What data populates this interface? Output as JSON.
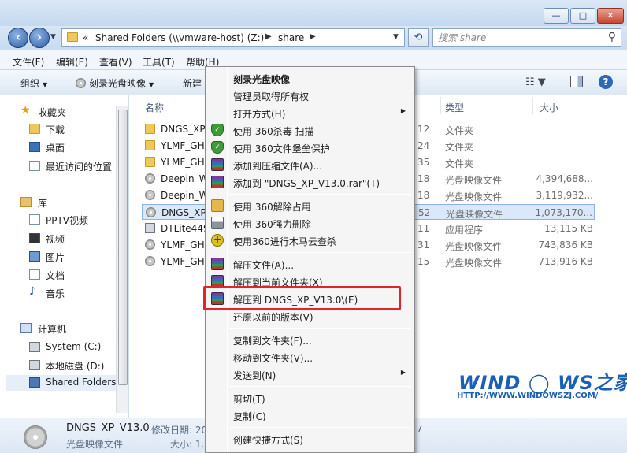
{
  "window": {
    "controls": {
      "minimize": "—",
      "maximize": "□",
      "close": "✕"
    }
  },
  "address": {
    "overflow": "«",
    "crumbs": [
      "Shared Folders (\\\\vmware-host) (Z:)",
      "share"
    ],
    "search_placeholder": "搜索 share"
  },
  "menubar": [
    "文件(F)",
    "编辑(E)",
    "查看(V)",
    "工具(T)",
    "帮助(H)"
  ],
  "toolbar": {
    "organize": "组织",
    "burn": "刻录光盘映像",
    "new": "新建"
  },
  "nav": {
    "favorites": "收藏夹",
    "downloads": "下载",
    "desktop": "桌面",
    "recent": "最近访问的位置",
    "libraries": "库",
    "pptv": "PPTV视频",
    "videos": "视频",
    "pictures": "图片",
    "documents": "文档",
    "music": "音乐",
    "computer": "计算机",
    "system_c": "System (C:)",
    "local_d": "本地磁盘 (D:)",
    "shared": "Shared Folders"
  },
  "columns": {
    "name": "名称",
    "type": "类型",
    "size": "大小"
  },
  "files": [
    {
      "name": "DNGS_XP",
      "date": "12",
      "type": "文件夹",
      "size": "",
      "icon": "folder-icon"
    },
    {
      "name": "YLMF_GH",
      "date": "24",
      "type": "文件夹",
      "size": "",
      "icon": "folder-icon"
    },
    {
      "name": "YLMF_GH",
      "date": "35",
      "type": "文件夹",
      "size": "",
      "icon": "folder-icon"
    },
    {
      "name": "Deepin_W",
      "date": "18",
      "type": "光盘映像文件",
      "size": "4,394,688...",
      "icon": "disc-image-icon"
    },
    {
      "name": "Deepin_W",
      "date": "18",
      "type": "光盘映像文件",
      "size": "3,119,932...",
      "icon": "disc-image-icon"
    },
    {
      "name": "DNGS_XP",
      "date": "52",
      "type": "光盘映像文件",
      "size": "1,073,170...",
      "icon": "disc-image-icon"
    },
    {
      "name": "DTLite449",
      "date": "11",
      "type": "应用程序",
      "size": "13,115 KB",
      "icon": "app-icon"
    },
    {
      "name": "YLMF_GH",
      "date": "31",
      "type": "光盘映像文件",
      "size": "743,836 KB",
      "icon": "disc-image-icon"
    },
    {
      "name": "YLMF_GH",
      "date": "15",
      "type": "光盘映像文件",
      "size": "713,916 KB",
      "icon": "disc-image-icon"
    }
  ],
  "details": {
    "filename": "DNGS_XP_V13.0",
    "modified_label": "修改日期: 20",
    "filetype": "光盘映像文件",
    "size_label": "大小: 1.",
    "tail": "7"
  },
  "context_menu": [
    {
      "label": "刻录光盘映像",
      "icon": "",
      "bold": true
    },
    {
      "label": "管理员取得所有权",
      "icon": ""
    },
    {
      "label": "打开方式(H)",
      "icon": "",
      "submenu": true
    },
    {
      "label": "使用 360杀毒 扫描",
      "icon": "shield"
    },
    {
      "label": "使用 360文件堡垒保护",
      "icon": "shield"
    },
    {
      "label": "添加到压缩文件(A)...",
      "icon": "rar"
    },
    {
      "label": "添加到 \"DNGS_XP_V13.0.rar\"(T)",
      "icon": "rar"
    },
    {
      "label": "使用 360解除占用",
      "icon": "unlock"
    },
    {
      "label": "使用 360强力删除",
      "icon": "printer"
    },
    {
      "label": "使用360进行木马云查杀",
      "icon": "trojan"
    },
    {
      "label": "解压文件(A)...",
      "icon": "rar"
    },
    {
      "label": "解压到当前文件夹(X)",
      "icon": "rar"
    },
    {
      "label": "解压到 DNGS_XP_V13.0\\(E)",
      "icon": "rar"
    },
    {
      "label": "还原以前的版本(V)",
      "icon": ""
    },
    {
      "label": "复制到文件夹(F)...",
      "icon": ""
    },
    {
      "label": "移动到文件夹(V)...",
      "icon": ""
    },
    {
      "label": "发送到(N)",
      "icon": "",
      "submenu": true
    },
    {
      "label": "剪切(T)",
      "icon": ""
    },
    {
      "label": "复制(C)",
      "icon": ""
    },
    {
      "label": "创建快捷方式(S)",
      "icon": ""
    }
  ],
  "watermark": {
    "brand": "WIND ◯ WS之家",
    "url": "HTTP://WWW.WINDOWSZJ.COM/"
  },
  "colors": {
    "highlight": "#e0262a",
    "accent": "#2f68b4",
    "selection": "#dbe8f9"
  }
}
